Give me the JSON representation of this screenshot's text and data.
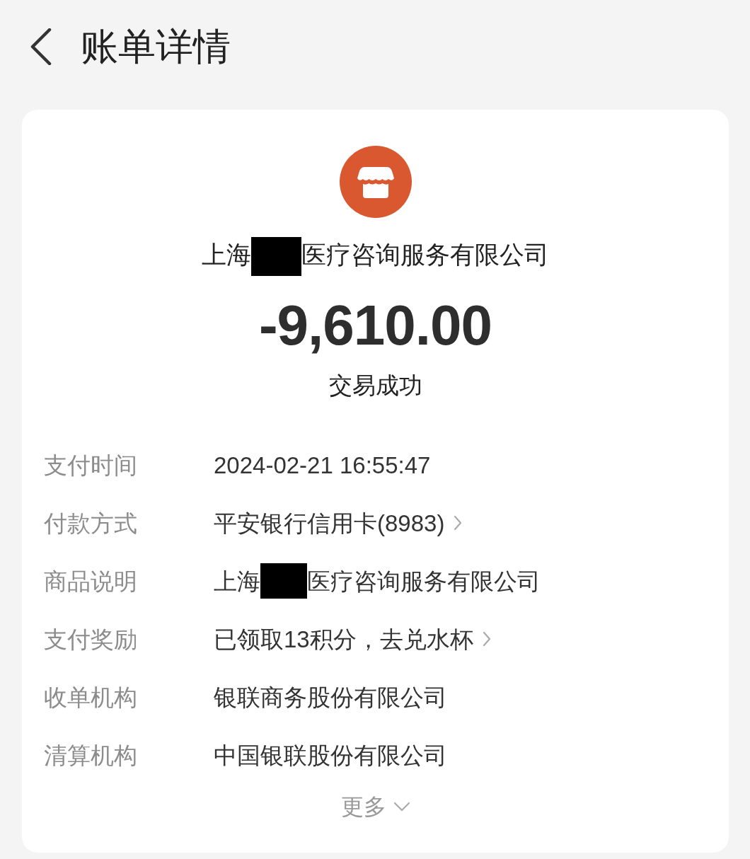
{
  "header": {
    "title": "账单详情"
  },
  "merchant": {
    "name_start": "上海",
    "redacted": true,
    "name_end": "医疗咨询服务有限公司"
  },
  "amount": "-9,610.00",
  "status": "交易成功",
  "rows": [
    {
      "label": "支付时间",
      "value": "2024-02-21 16:55:47",
      "redacted": false,
      "chevron": false
    },
    {
      "label": "付款方式",
      "value": "平安银行信用卡(8983)",
      "redacted": false,
      "chevron": true
    },
    {
      "label": "商品说明",
      "value": "上海",
      "redacted": true,
      "value_end": "医疗咨询服务有限公司",
      "chevron": false
    },
    {
      "label": "支付奖励",
      "value": "已领取13积分，去兑水杯",
      "redacted": false,
      "chevron": true
    },
    {
      "label": "收单机构",
      "value": "银联商务股份有限公司",
      "redacted": false,
      "chevron": false
    },
    {
      "label": "清算机构",
      "value": "中国银联股份有限公司",
      "redacted": false,
      "chevron": false
    }
  ],
  "more": {
    "label": "更多",
    "expanded": false
  }
}
